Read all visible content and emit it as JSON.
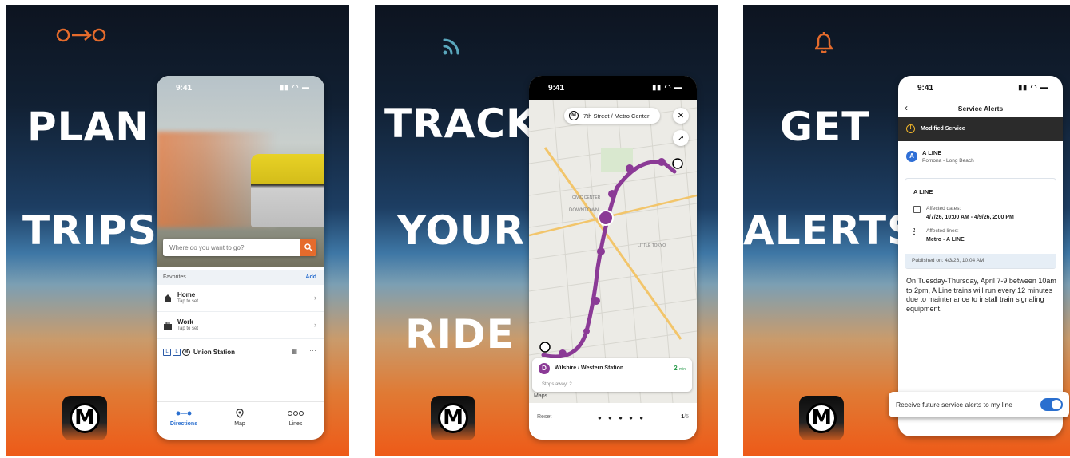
{
  "colors": {
    "orange": "#e56b2c",
    "teal": "#5aa7bd",
    "blue": "#2a6fcf",
    "purple": "#8b3a96"
  },
  "panel1": {
    "word1": "PLAN",
    "word2": "TRIPS",
    "logo_letter": "M",
    "phone": {
      "time": "9:41",
      "search_placeholder": "Where do you want to go?",
      "favorites_label": "Favorites",
      "add_label": "Add",
      "favorites": [
        {
          "name": "Home",
          "sub": "Tap to set"
        },
        {
          "name": "Work",
          "sub": "Tap to set"
        }
      ],
      "station": {
        "name": "Union Station",
        "line_badges": [
          "L",
          "L",
          "M"
        ]
      },
      "tabs": [
        "Directions",
        "Map",
        "Lines"
      ]
    }
  },
  "panel2": {
    "word1": "TRACK",
    "word2": "YOUR",
    "word3": "RIDE",
    "logo_letter": "M",
    "phone": {
      "time": "9:41",
      "station_pill": "7th Street / Metro Center",
      "station_badge": "M",
      "map_labels": [
        "CIVIC CENTER",
        "DOWNTOWN",
        "LITTLE TOKYO"
      ],
      "stop_badge": "D",
      "stop_name": "Wilshire / Western Station",
      "eta_value": "2",
      "eta_unit": "min",
      "stops_away": "Stops away: 2",
      "maps_label": "Maps",
      "reset_label": "Reset",
      "dots": "● ● ● ● ●",
      "page_current": "1",
      "page_total": "5"
    }
  },
  "panel3": {
    "word1": "GET",
    "word2": "ALERTS",
    "logo_letter": "M",
    "phone": {
      "time": "9:41",
      "title": "Service Alerts",
      "modified": "Modified Service",
      "line_badge": "A",
      "line_name": "A LINE",
      "line_route": "Pomona - Long Beach",
      "card_title": "A LINE",
      "dates_label": "Affected dates:",
      "dates_value": "4/7/26, 10:00 AM - 4/9/26, 2:00 PM",
      "lines_label": "Affected lines:",
      "lines_value": "Metro - A LINE",
      "published": "Published on: 4/3/26, 10:04 AM",
      "body": "On Tuesday-Thursday, April 7-9 between 10am to 2pm, A Line trains will run every 12 minutes due to maintenance to install train signaling equipment."
    },
    "toggle_label": "Receive future service alerts to my line",
    "toggle_on": true
  }
}
